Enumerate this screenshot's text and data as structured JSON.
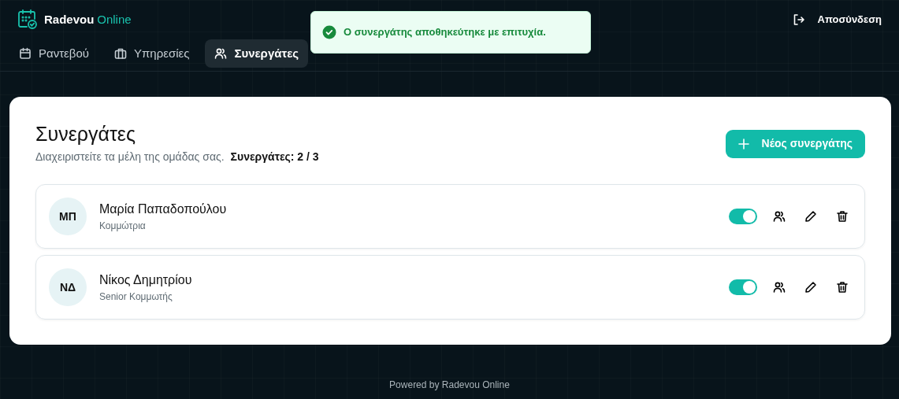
{
  "brand": {
    "name": "Radevou",
    "suffix": "Online"
  },
  "nav": [
    {
      "label": "Ραντεβού",
      "kind": "calendar",
      "selected": false
    },
    {
      "label": "Υπηρεσίες",
      "kind": "briefcase",
      "selected": false
    },
    {
      "label": "Συνεργάτες",
      "kind": "users",
      "selected": true
    }
  ],
  "logout": {
    "label": "Αποσύνδεση"
  },
  "toast": {
    "message": "Ο συνεργάτης αποθηκεύτηκε με επιτυχία."
  },
  "page": {
    "title": "Συνεργάτες",
    "subtitle": "Διαχειριστείτε τα μέλη της ομάδας σας.",
    "count": "Συνεργάτες: 2 / 3",
    "new_button": "Νέος συνεργάτης"
  },
  "partners": [
    {
      "initials": "ΜΠ",
      "name": "Μαρία Παπαδοπούλου",
      "role": "Κομμώτρια",
      "on": true
    },
    {
      "initials": "ΝΔ",
      "name": "Νίκος Δημητρίου",
      "role": "Senior Κομμωτής",
      "on": true
    }
  ],
  "footer": "Powered by Radevou Online"
}
